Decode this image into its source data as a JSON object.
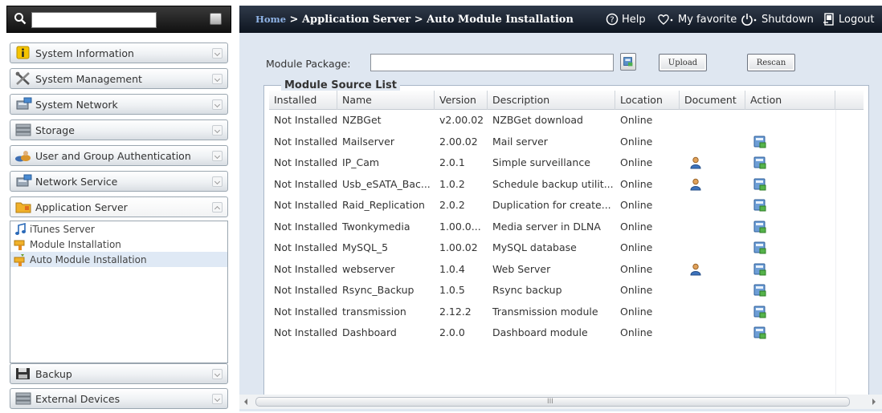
{
  "left": {
    "search": {
      "value": "",
      "placeholder": ""
    },
    "menu": [
      {
        "id": "system-information",
        "label": "System Information",
        "icon": "info-icon"
      },
      {
        "id": "system-management",
        "label": "System Management",
        "icon": "tools-icon"
      },
      {
        "id": "system-network",
        "label": "System Network",
        "icon": "network-icon"
      },
      {
        "id": "storage",
        "label": "Storage",
        "icon": "storage-icon"
      },
      {
        "id": "user-group-auth",
        "label": "User and Group Authentication",
        "icon": "users-icon"
      },
      {
        "id": "network-service",
        "label": "Network Service",
        "icon": "network-icon"
      },
      {
        "id": "application-server",
        "label": "Application Server",
        "icon": "folder-icon"
      }
    ],
    "submenu": [
      {
        "label": "iTunes Server",
        "icon": "music-note-icon"
      },
      {
        "label": "Module Installation",
        "icon": "module-icon"
      },
      {
        "label": "Auto Module Installation",
        "icon": "auto-module-icon",
        "active": true
      }
    ],
    "bottom_menu": [
      {
        "id": "backup",
        "label": "Backup",
        "icon": "backup-icon"
      },
      {
        "id": "external-devices",
        "label": "External Devices",
        "icon": "storage-icon"
      }
    ]
  },
  "topbar": {
    "breadcrumb_home": "Home",
    "breadcrumb_rest": " > Application Server > Auto Module Installation",
    "help": "Help",
    "favorite": "My favorite",
    "shutdown": "Shutdown",
    "logout": "Logout"
  },
  "form": {
    "package_label": "Module Package:",
    "package_value": "",
    "upload_label": "Upload",
    "rescan_label": "Rescan"
  },
  "source_list": {
    "legend": "Module Source List",
    "columns": [
      "Installed",
      "Name",
      "Version",
      "Description",
      "Location",
      "Document",
      "Action"
    ],
    "rows": [
      {
        "installed": "Not Installed",
        "name": "NZBGet",
        "version": "v2.00.02",
        "description": "NZBGet download",
        "location": "Online",
        "document": false,
        "action": false
      },
      {
        "installed": "Not Installed",
        "name": "Mailserver",
        "version": "2.00.02",
        "description": "Mail server",
        "location": "Online",
        "document": false,
        "action": true
      },
      {
        "installed": "Not Installed",
        "name": "IP_Cam",
        "version": "2.0.1",
        "description": "Simple surveillance",
        "location": "Online",
        "document": true,
        "action": true
      },
      {
        "installed": "Not Installed",
        "name": "Usb_eSATA_Bac...",
        "version": "1.0.2",
        "description": "Schedule backup utilit...",
        "location": "Online",
        "document": true,
        "action": true
      },
      {
        "installed": "Not Installed",
        "name": "Raid_Replication",
        "version": "2.0.2",
        "description": "Duplication for create...",
        "location": "Online",
        "document": false,
        "action": true
      },
      {
        "installed": "Not Installed",
        "name": "Twonkymedia",
        "version": "1.00.0...",
        "description": "Media server in DLNA",
        "location": "Online",
        "document": false,
        "action": true
      },
      {
        "installed": "Not Installed",
        "name": "MySQL_5",
        "version": "1.00.02",
        "description": "MySQL database",
        "location": "Online",
        "document": false,
        "action": true
      },
      {
        "installed": "Not Installed",
        "name": "webserver",
        "version": "1.0.4",
        "description": "Web Server",
        "location": "Online",
        "document": true,
        "action": true
      },
      {
        "installed": "Not Installed",
        "name": "Rsync_Backup",
        "version": "1.0.5",
        "description": "Rsync backup",
        "location": "Online",
        "document": false,
        "action": true
      },
      {
        "installed": "Not Installed",
        "name": "transmission",
        "version": "2.12.2",
        "description": "Transmission module",
        "location": "Online",
        "document": false,
        "action": true
      },
      {
        "installed": "Not Installed",
        "name": "Dashboard",
        "version": "2.0.0",
        "description": "Dashboard module",
        "location": "Online",
        "document": false,
        "action": true
      }
    ]
  },
  "hscroll": {
    "grip": "III"
  },
  "colors": {
    "topbar": "#1a2433",
    "content_bg": "#dfe7f1",
    "accent": "#8fb3e6"
  }
}
